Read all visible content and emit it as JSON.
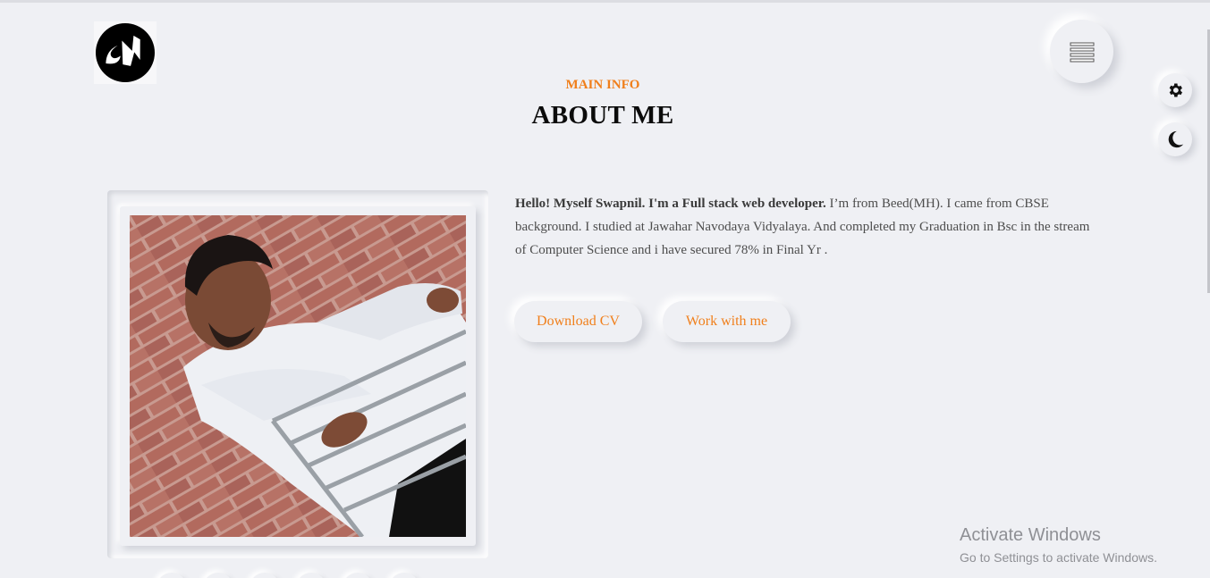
{
  "logo": {
    "text": "SM",
    "icon": "sm-monogram-logo"
  },
  "header": {
    "menu_icon": "hamburger-icon",
    "settings_icon": "gear-icon",
    "theme_icon": "moon-icon"
  },
  "about": {
    "subtitle": "MAIN INFO",
    "title": "ABOUT ME",
    "bio_intro": "Hello! Myself Swapnil. I'm a Full stack web developer.",
    "bio_rest": " I’m from Beed(MH). I came from CBSE background. I studied at Jawahar Navodaya Vidyalaya. And completed my Graduation in Bsc in the stream of Computer Science and i have secured 78% in Final Yr .",
    "photo_alt": "profile-photo"
  },
  "buttons": {
    "download_cv": "Download CV",
    "work_with_me": "Work with me"
  },
  "colors": {
    "accent": "#f07f1b",
    "background": "#eff0f4",
    "heading": "#0b0b0b"
  },
  "watermark": {
    "title": "Activate Windows",
    "subtitle": "Go to Settings to activate Windows."
  }
}
